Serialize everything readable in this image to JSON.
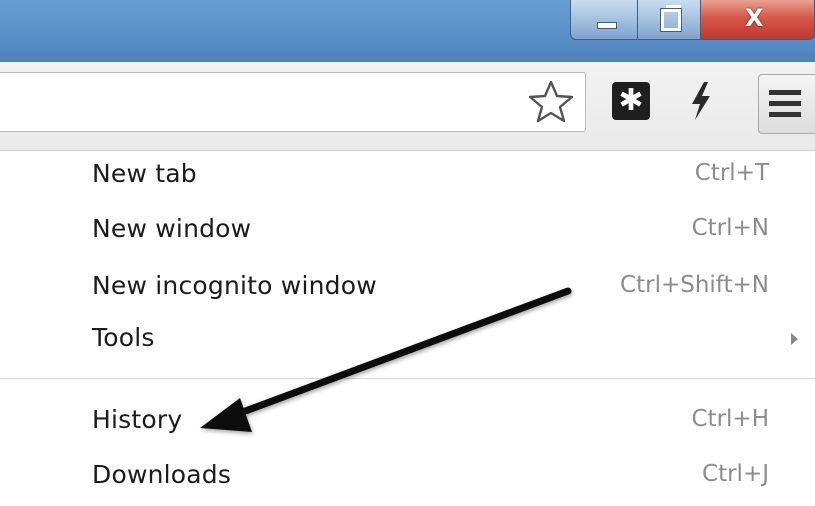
{
  "window": {
    "controls": {
      "minimize_icon": "minimize-icon",
      "maximize_icon": "restore-icon",
      "close_label": "X"
    },
    "colors": {
      "titlebar": "#5b8fc7",
      "close": "#c0392b",
      "arrow": "#111111"
    }
  },
  "toolbar": {
    "bookmark_icon": "star-icon",
    "extension_icon_glyph": "✱",
    "lightning_icon": "lightning-icon",
    "menu_icon": "hamburger-menu-icon"
  },
  "menu": {
    "items": [
      {
        "label": "New tab",
        "shortcut": "Ctrl+T"
      },
      {
        "label": "New window",
        "shortcut": "Ctrl+N"
      },
      {
        "label": "New incognito window",
        "shortcut": "Ctrl+Shift+N"
      },
      {
        "label": "Tools",
        "shortcut": ""
      },
      {
        "label": "History",
        "shortcut": "Ctrl+H"
      },
      {
        "label": "Downloads",
        "shortcut": "Ctrl+J"
      }
    ]
  }
}
